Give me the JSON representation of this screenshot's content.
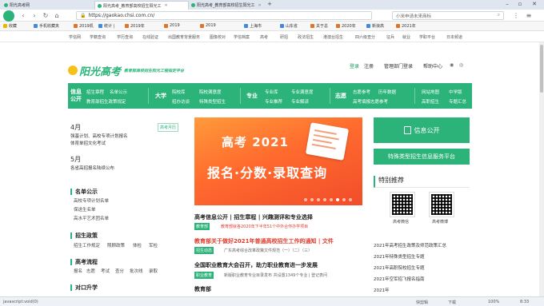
{
  "browser": {
    "tabs": [
      {
        "label": "阳光高考网",
        "active": false
      },
      {
        "label": "阳光高考_教育部高校招生阳光工",
        "active": true
      },
      {
        "label": "阳光高考_教育部高校招生阳光工",
        "active": false
      }
    ],
    "url": "https://gaokao.chsi.com.cn/",
    "search_placeholder": "小米申请未来商标",
    "bookmarks": [
      "收藏",
      "手机收藏夹",
      "2019机",
      "统计 |",
      "2019年",
      "2019",
      "2019",
      "上海市",
      "山东省",
      "关于总",
      "2020年",
      "新浪高",
      "2021年"
    ]
  },
  "site_nav": [
    "学信网",
    "学籍查询",
    "学历查询",
    "在线验证",
    "出国教育背景服务",
    "图像校对",
    "学信档案",
    "高考",
    "研招",
    "政法招生",
    "港澳台招生",
    "四六级查分",
    "征兵",
    "就业",
    "学职平台",
    "日本频道"
  ],
  "header": {
    "logo_text": "阳光高考",
    "logo_sub": "教育部高校招生阳光工程指定平台",
    "login": "登录",
    "register": "注册",
    "admin_login": "管理部门登录",
    "help": "帮助中心"
  },
  "green_nav": {
    "cat1": "信息公开",
    "cat1_items": [
      "招生章程",
      "名单公示",
      "教育部招生政策规定"
    ],
    "cat2": "大学",
    "cat2_items": [
      "院校库",
      "院校满意度",
      "招办访谈",
      "特殊类型招生"
    ],
    "cat3": "专业",
    "cat3_items": [
      "专业库",
      "专业满意度",
      "专业推荐",
      "专业解读"
    ],
    "cat4": "志愿",
    "cat4_items": [
      "志愿参考",
      "历年数据",
      "高考填报志愿参考"
    ],
    "cat5_items": [
      "网站地图",
      "中学版",
      "高职招生",
      "专题汇总"
    ]
  },
  "left": {
    "items": [
      {
        "month": "4月",
        "badge": "高考月历",
        "lines": [
          "强基计划、高校专项计划报名",
          "体育单招文化考试"
        ]
      },
      {
        "month": "5月",
        "lines": [
          "各省高招报名陆续公布"
        ]
      }
    ],
    "sections": [
      {
        "title": "名单公示",
        "links": [
          "高校专项计划名单",
          "保送生名单",
          "高水平艺术团名单"
        ]
      },
      {
        "title": "招生政策",
        "links": [
          "招生工作规定",
          "照顾政策",
          "体检",
          "军检"
        ]
      },
      {
        "title": "高考流程",
        "links": [
          "报名",
          "志愿",
          "考试",
          "查分",
          "批次线",
          "录取"
        ]
      },
      {
        "title": "对口升学",
        "links": []
      }
    ]
  },
  "banner": {
    "year_text": "高考 2021",
    "main_text": "报名·分数·录取查询"
  },
  "news": [
    {
      "headline": "高考信息公开 | 招生章程 | 兴趣测评和专业选择",
      "tag": "教育部",
      "sub": "教育部就各2020年下半年51个中外合作办学项目",
      "red": false
    },
    {
      "headline": "教育部关于做好2021年普通高校招生工作的通知 | 文件",
      "tag": "招生动态",
      "sub": "广东高考综合改革政策文件规范（一）（二）（三）",
      "red": true
    },
    {
      "headline": "全国职业教育大会召开，助力职业教育进一步发展",
      "tag": "职业教育",
      "sub": "新版职业教育专业目录发布 共设置1349个专业 | 登记表问",
      "red": false
    },
    {
      "headline": "教育部",
      "tag": "",
      "sub": "",
      "red": false
    }
  ],
  "right": {
    "info_button": "信息公开",
    "special_button": "特殊类型招生信息服务平台",
    "recommend_title": "特别推荐",
    "qr_labels": [
      "高考微信",
      "高考微博"
    ],
    "links": [
      "2021年高考招生政策及师范政策汇总",
      "2021年特殊类型招生专题",
      "2021年高职院校招生专题",
      "2021年空军招飞报名指南",
      "2021年"
    ]
  },
  "status": {
    "left_text": "javascript:void(0)",
    "right_items": [
      "快剪辑",
      "下载",
      "100%",
      "8:33"
    ]
  },
  "colors": {
    "brand_green": "#2bb37a",
    "accent_red": "#e23b2b",
    "banner_orange": "#ff6b2e"
  }
}
